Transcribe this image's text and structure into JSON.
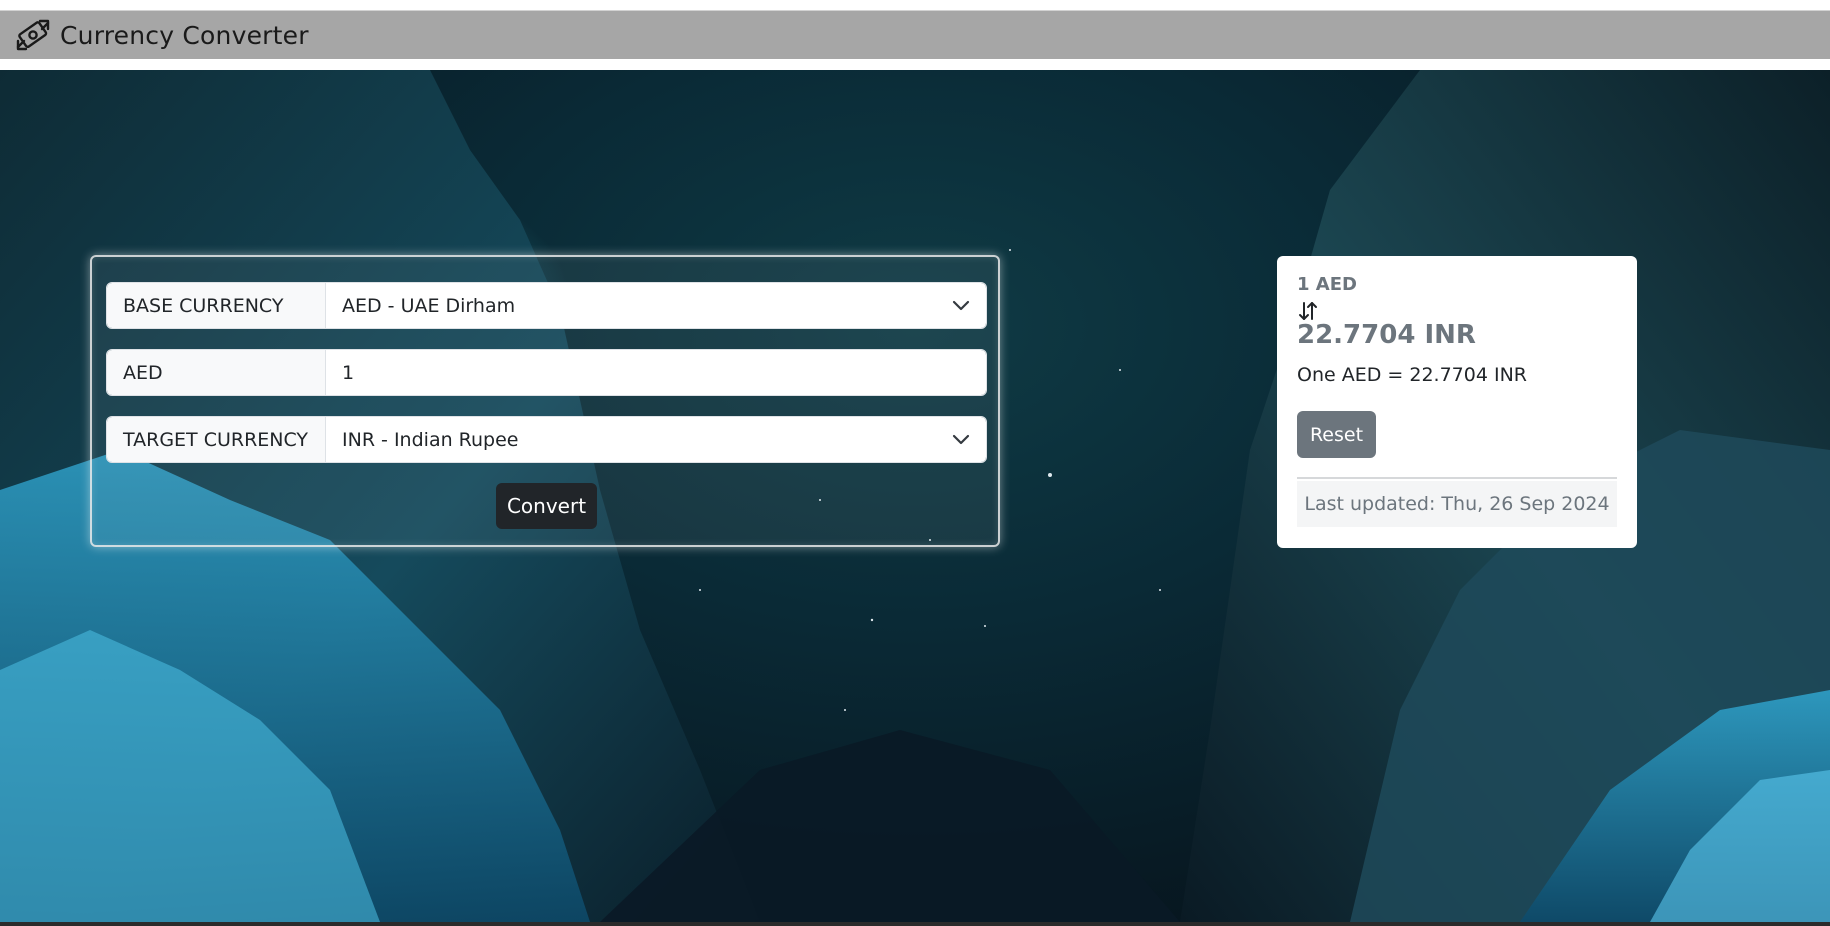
{
  "app": {
    "title": "Currency Converter",
    "icon": "currency-exchange-icon"
  },
  "form": {
    "base": {
      "label": "BASE CURRENCY",
      "selected": "AED - UAE Dirham"
    },
    "amount": {
      "label": "AED",
      "value": "1"
    },
    "target": {
      "label": "TARGET CURRENCY",
      "selected": "INR - Indian Rupee"
    },
    "convert_label": "Convert"
  },
  "result": {
    "from": "1 AED",
    "swap_icon": "swap-vertical-icon",
    "to": "22.7704 INR",
    "rate": "One AED = 22.7704 INR",
    "reset_label": "Reset",
    "last_updated": "Last updated: Thu, 26 Sep 2024"
  },
  "colors": {
    "navbar": "#a6a6a6",
    "convert_button": "#212529",
    "reset_button": "#6c757d",
    "muted_text": "#6c757d"
  }
}
